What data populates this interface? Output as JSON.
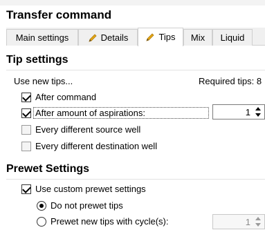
{
  "window": {
    "title": "Transfer command"
  },
  "tabs": [
    {
      "label": "Main settings"
    },
    {
      "label": "Details",
      "icon": "pencil-icon"
    },
    {
      "label": "Tips",
      "icon": "pencil-icon"
    },
    {
      "label": "Mix"
    },
    {
      "label": "Liquid"
    }
  ],
  "active_tab": "Tips",
  "tip_settings": {
    "title": "Tip settings",
    "use_new_tips_label": "Use new tips...",
    "required_tips_label": "Required tips: 8",
    "options": [
      {
        "label": "After command",
        "checked": true
      },
      {
        "label": "After amount of aspirations:",
        "checked": true
      },
      {
        "label": "Every different source well",
        "checked": false
      },
      {
        "label": "Every different destination well",
        "checked": false
      }
    ],
    "aspirations_value": "1"
  },
  "prewet_settings": {
    "title": "Prewet Settings",
    "use_custom_label": "Use custom prewet settings",
    "use_custom_checked": true,
    "radios": [
      {
        "label": "Do not prewet tips",
        "selected": true
      },
      {
        "label": "Prewet new tips with cycle(s):",
        "selected": false
      }
    ],
    "cycles_value": "1"
  },
  "colors": {
    "accent_pencil": "#e6a817",
    "tab_bg": "#f0f0f0",
    "border": "#cfcfcf"
  }
}
